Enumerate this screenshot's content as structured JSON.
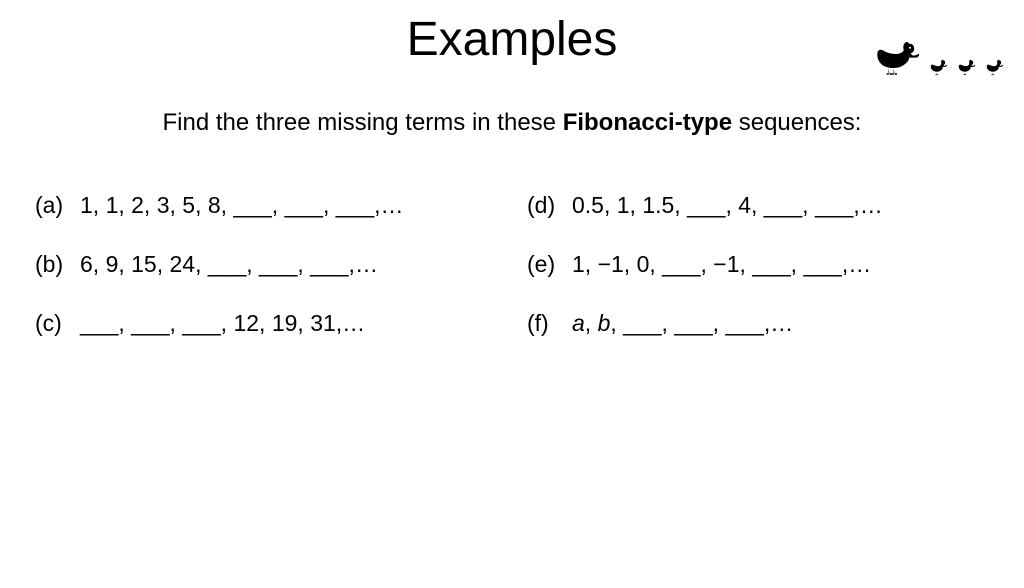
{
  "title": "Examples",
  "instruction_pre": "Find the three missing terms in these ",
  "instruction_bold": "Fibonacci-type",
  "instruction_post": " sequences:",
  "left": [
    {
      "label": "(a)",
      "sequence": "1, 1, 2, 3, 5, 8, ___, ___, ___,…"
    },
    {
      "label": "(b)",
      "sequence": "6, 9, 15, 24, ___, ___, ___,…"
    },
    {
      "label": "(c)",
      "sequence": "___, ___, ___, 12, 19, 31,…"
    }
  ],
  "right": [
    {
      "label": "(d)",
      "sequence": "0.5, 1, 1.5, ___, 4, ___, ___,…"
    },
    {
      "label": "(e)",
      "sequence": "1, −1, 0, ___, −1, ___, ___,…"
    },
    {
      "label": "(f)",
      "sequence_html": "<span class='italic'>a</span>, <span class='italic'>b</span>, ___, ___, ___,…"
    }
  ]
}
